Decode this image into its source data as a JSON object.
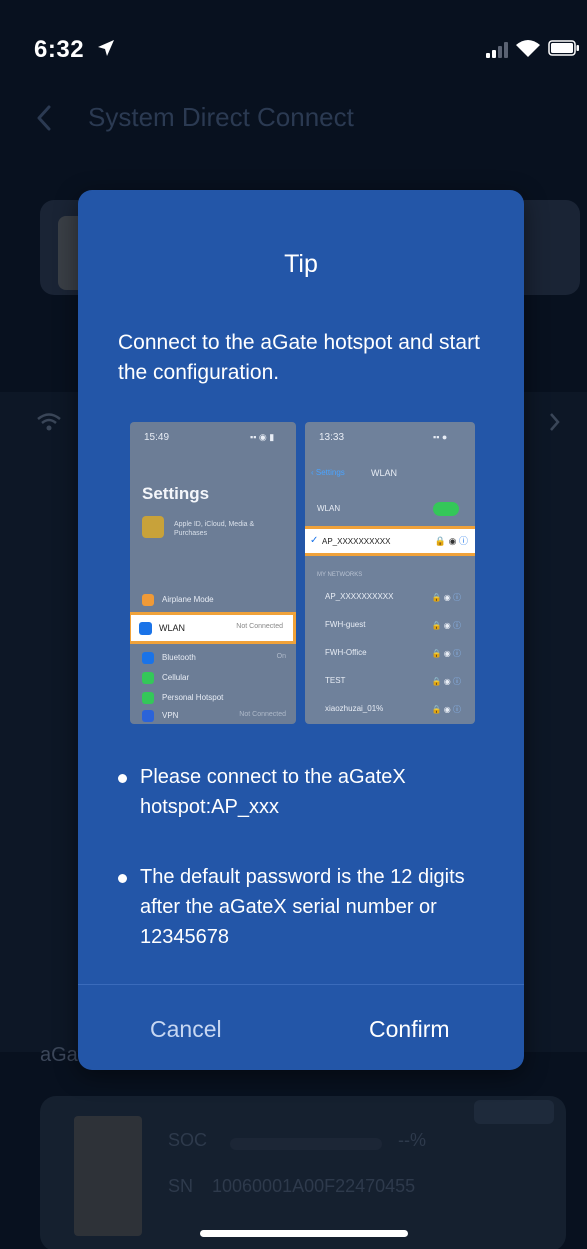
{
  "status_bar": {
    "time": "6:32"
  },
  "nav": {
    "title": "System Direct Connect"
  },
  "background": {
    "section_label": "aGa",
    "device": {
      "soc_label": "SOC",
      "soc_value": "--%",
      "sn_label": "SN",
      "sn_value": "10060001A00F22470455"
    }
  },
  "dialog": {
    "title": "Tip",
    "message": "Connect to the aGate hotspot and start the configuration.",
    "bullets": [
      "Please connect to the aGateX hotspot:AP_xxx",
      "The default password is the 12 digits after the aGateX serial number or 12345678"
    ],
    "cancel_label": "Cancel",
    "confirm_label": "Confirm"
  },
  "guide_image": {
    "left_phone": {
      "time": "15:49",
      "title": "Settings",
      "profile_text": "Apple ID, iCloud, Media & Purchases",
      "rows": [
        {
          "label": "Airplane Mode",
          "value": "",
          "color": "#f09a37"
        },
        {
          "label": "Bluetooth",
          "value": "On",
          "color": "#1a73e8"
        },
        {
          "label": "Cellular",
          "value": "",
          "color": "#34c759"
        },
        {
          "label": "Personal Hotspot",
          "value": "",
          "color": "#34c759"
        },
        {
          "label": "VPN",
          "value": "Not Connected",
          "color": "#2b63d9"
        }
      ],
      "wlan_label": "WLAN",
      "wlan_value": "Not Connected"
    },
    "right_phone": {
      "time": "13:33",
      "back_label": "Settings",
      "screen_title": "WLAN",
      "toggle_label": "WLAN",
      "connected_network": "AP_XXXXXXXXXX",
      "section_label": "MY NETWORKS",
      "networks": [
        "AP_XXXXXXXXXX",
        "FWH-guest",
        "FWH-Office",
        "TEST",
        "xiaozhuzai_01%"
      ]
    }
  }
}
